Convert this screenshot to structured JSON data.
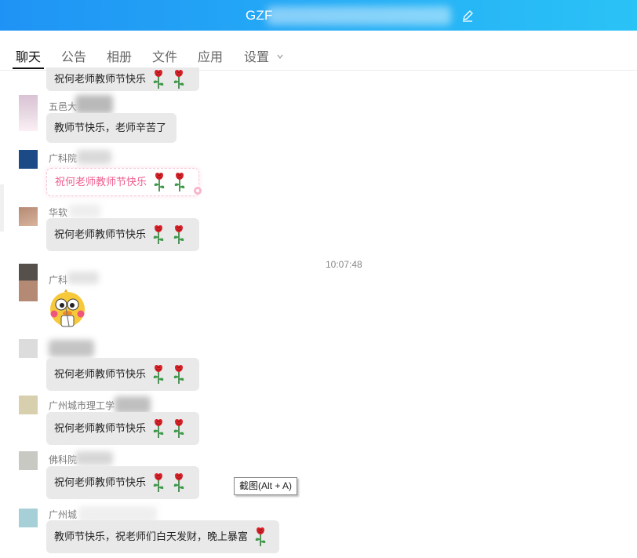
{
  "window": {
    "title": "GZF",
    "edit_icon": "edit-icon",
    "colors": {
      "title_gradient_start": "#1f93f5",
      "title_gradient_end": "#2ac3f6"
    }
  },
  "tabs": [
    {
      "label": "聊天",
      "active": true
    },
    {
      "label": "公告",
      "active": false
    },
    {
      "label": "相册",
      "active": false
    },
    {
      "label": "文件",
      "active": false
    },
    {
      "label": "应用",
      "active": false
    },
    {
      "label": "设置",
      "active": false,
      "icon": "chevron-down-icon"
    }
  ],
  "messages": [
    {
      "text": "祝何老师教师节快乐",
      "roses": 2
    },
    {
      "sender": "五邑大",
      "text": "教师节快乐，老师辛苦了",
      "roses": 0
    },
    {
      "sender": "广科院",
      "text": "祝何老师教师节快乐",
      "roses": 2,
      "style": "pink"
    },
    {
      "sender": "华软",
      "text": "祝何老师教师节快乐",
      "roses": 2
    },
    {
      "timestamp": "10:07:48"
    },
    {
      "sender": "广科",
      "sticker": "duck-sticker"
    },
    {
      "sender": "",
      "text": "祝何老师教师节快乐",
      "roses": 2
    },
    {
      "sender": "广州城市理工学",
      "text": "祝何老师教师节快乐",
      "roses": 2
    },
    {
      "sender": "佛科院",
      "text": "祝何老师教师节快乐",
      "roses": 2
    },
    {
      "sender": "广州城",
      "text": "教师节快乐，祝老师们白天发财，晚上暴富",
      "roses": 1
    }
  ],
  "tooltip": "截图(Alt + A)"
}
